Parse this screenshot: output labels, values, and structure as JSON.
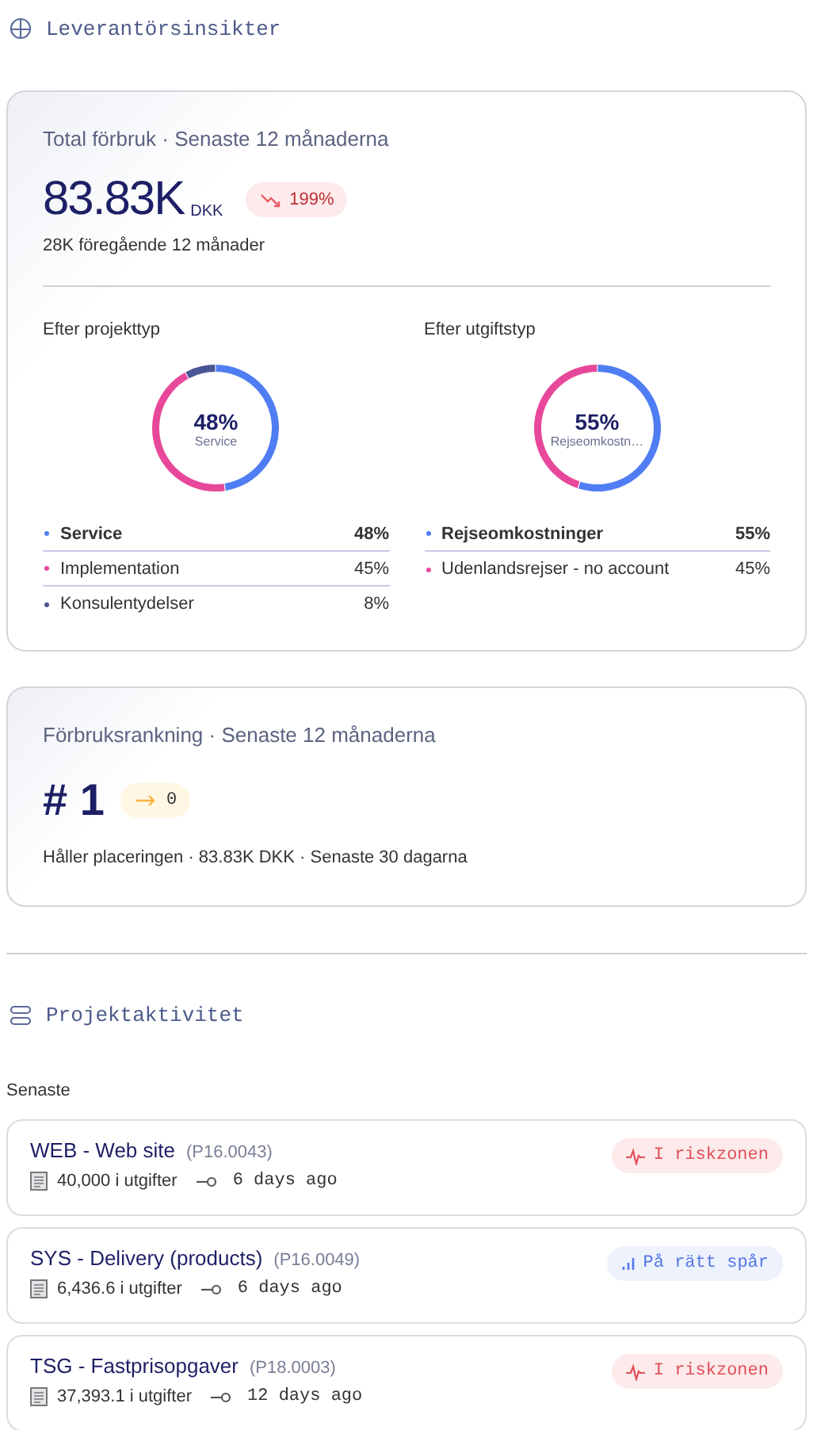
{
  "header": {
    "title": "Leverantörsinsikter"
  },
  "spend_card": {
    "title": "Total förbruk · Senaste 12 månaderna",
    "amount": "83.83K",
    "currency": "DKK",
    "trend": {
      "kind": "down",
      "value": "199%"
    },
    "previous": "28K föregående 12 månader",
    "breakdowns": [
      {
        "title": "Efter projekttyp",
        "center_value": "48%",
        "center_label": "Service",
        "chart_data": {
          "type": "donut",
          "categories": [
            "Service",
            "Implementation",
            "Konsulentydelser"
          ],
          "values": [
            48,
            45,
            8
          ]
        },
        "legend": [
          {
            "value": "48%",
            "color": "#4f7df3",
            "selected": true
          },
          {
            "value": "45%",
            "color": "#e8489a",
            "selected": false
          },
          {
            "value": "8%",
            "color": "#4a5596",
            "selected": false
          }
        ]
      },
      {
        "title": "Efter utgiftstyp",
        "center_value": "55%",
        "center_label": "Rejseomkostn…",
        "chart_data": {
          "type": "donut",
          "categories": [
            "Rejseomkostninger",
            "Udenlandsrejser - no account"
          ],
          "values": [
            55,
            45
          ]
        },
        "legend": [
          {
            "value": "55%",
            "color": "#4f7df3",
            "selected": true
          },
          {
            "value": "45%",
            "color": "#e8489a",
            "selected": false
          }
        ]
      }
    ]
  },
  "rank_card": {
    "title": "Förbruksrankning · Senaste 12 månaderna",
    "rank": "# 1",
    "change": {
      "kind": "flat",
      "value": "0"
    },
    "note": "Håller placeringen · 83.83K DKK · Senaste 30 dagarna"
  },
  "activity": {
    "title": "Projektaktivitet",
    "subtitle": "Senaste",
    "projects": [
      {
        "name": "WEB - Web site",
        "code": "(P16.0043)",
        "expenses": "40,000 i utgifter",
        "age": "6 days ago",
        "status": {
          "kind": "risk",
          "label": "I riskzonen"
        }
      },
      {
        "name": "SYS - Delivery (products)",
        "code": "(P16.0049)",
        "expenses": "6,436.6 i utgifter",
        "age": "6 days ago",
        "status": {
          "kind": "on_track",
          "label": "På rätt spår"
        }
      },
      {
        "name": "TSG - Fastprisopgaver",
        "code": "(P18.0003)",
        "expenses": "37,393.1 i utgifter",
        "age": "12 days ago",
        "status": {
          "kind": "risk",
          "label": "I riskzonen"
        }
      }
    ]
  }
}
